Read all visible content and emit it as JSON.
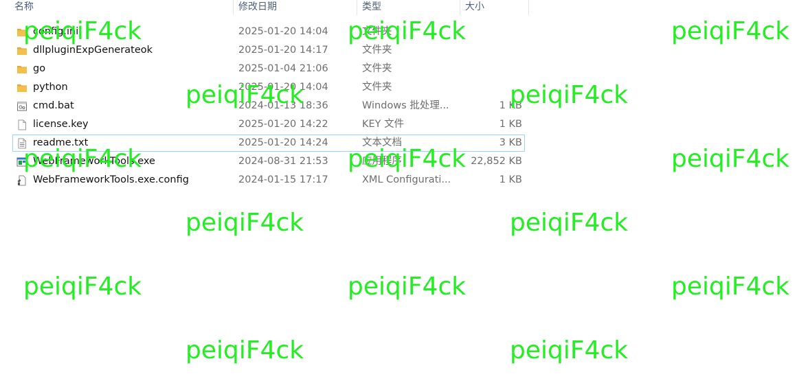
{
  "columns": {
    "name": "名称",
    "date": "修改日期",
    "type": "类型",
    "size": "大小"
  },
  "files": [
    {
      "name": "config.ini",
      "date": "2025-01-20 14:04",
      "type": "文件夹",
      "size": "",
      "icon": "folder-icon",
      "icon_color": "#f3c04b"
    },
    {
      "name": "dllpluginExpGenerateok",
      "date": "2025-01-20 14:17",
      "type": "文件夹",
      "size": "",
      "icon": "folder-icon",
      "icon_color": "#f3c04b"
    },
    {
      "name": "go",
      "date": "2025-01-04 21:06",
      "type": "文件夹",
      "size": "",
      "icon": "folder-icon",
      "icon_color": "#f3c04b"
    },
    {
      "name": "python",
      "date": "2025-01-20 14:04",
      "type": "文件夹",
      "size": "",
      "icon": "folder-icon",
      "icon_color": "#f3c04b"
    },
    {
      "name": "cmd.bat",
      "date": "2024-01-13 18:36",
      "type": "Windows 批处理...",
      "size": "1 KB",
      "icon": "batch-file-icon",
      "icon_color": "#6d6d6d"
    },
    {
      "name": "license.key",
      "date": "2025-01-20 14:22",
      "type": "KEY 文件",
      "size": "1 KB",
      "icon": "blank-file-icon",
      "icon_color": "#9a9a9a"
    },
    {
      "name": "readme.txt",
      "date": "2025-01-20 14:24",
      "type": "文本文档",
      "size": "3 KB",
      "icon": "text-file-icon",
      "icon_color": "#9a9a9a"
    },
    {
      "name": "WebFrameworkTools.exe",
      "date": "2024-08-31 21:53",
      "type": "应用程序",
      "size": "22,852 KB",
      "icon": "exe-app-icon",
      "icon_color": "#2b7bd6"
    },
    {
      "name": "WebFrameworkTools.exe.config",
      "date": "2024-01-15 17:17",
      "type": "XML Configurati...",
      "size": "1 KB",
      "icon": "config-file-icon",
      "icon_color": "#555555"
    }
  ],
  "focused_row": "readme.txt",
  "watermark": {
    "text": "peiqiF4ck",
    "color": "#22ee22"
  }
}
